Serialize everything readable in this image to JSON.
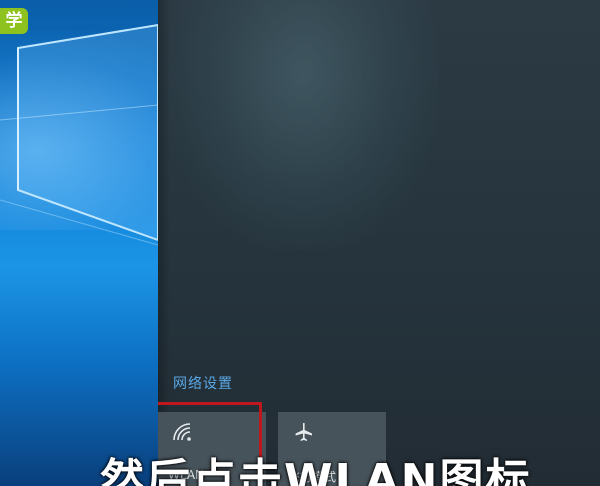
{
  "desktop": {
    "corner_badge": "学"
  },
  "action_center": {
    "section_title": "网络设置",
    "tiles": [
      {
        "label": "WLAN",
        "icon": "wifi-icon"
      },
      {
        "label": "飞行模式",
        "icon": "airplane-icon"
      }
    ]
  },
  "overlay": {
    "subtitle": "然后点击WLAN图标"
  },
  "colors": {
    "section_title": "#5aa8e6",
    "highlight_box": "#c0171e",
    "tile_bg": "#47535b",
    "badge_bg": "#8dc21f"
  }
}
